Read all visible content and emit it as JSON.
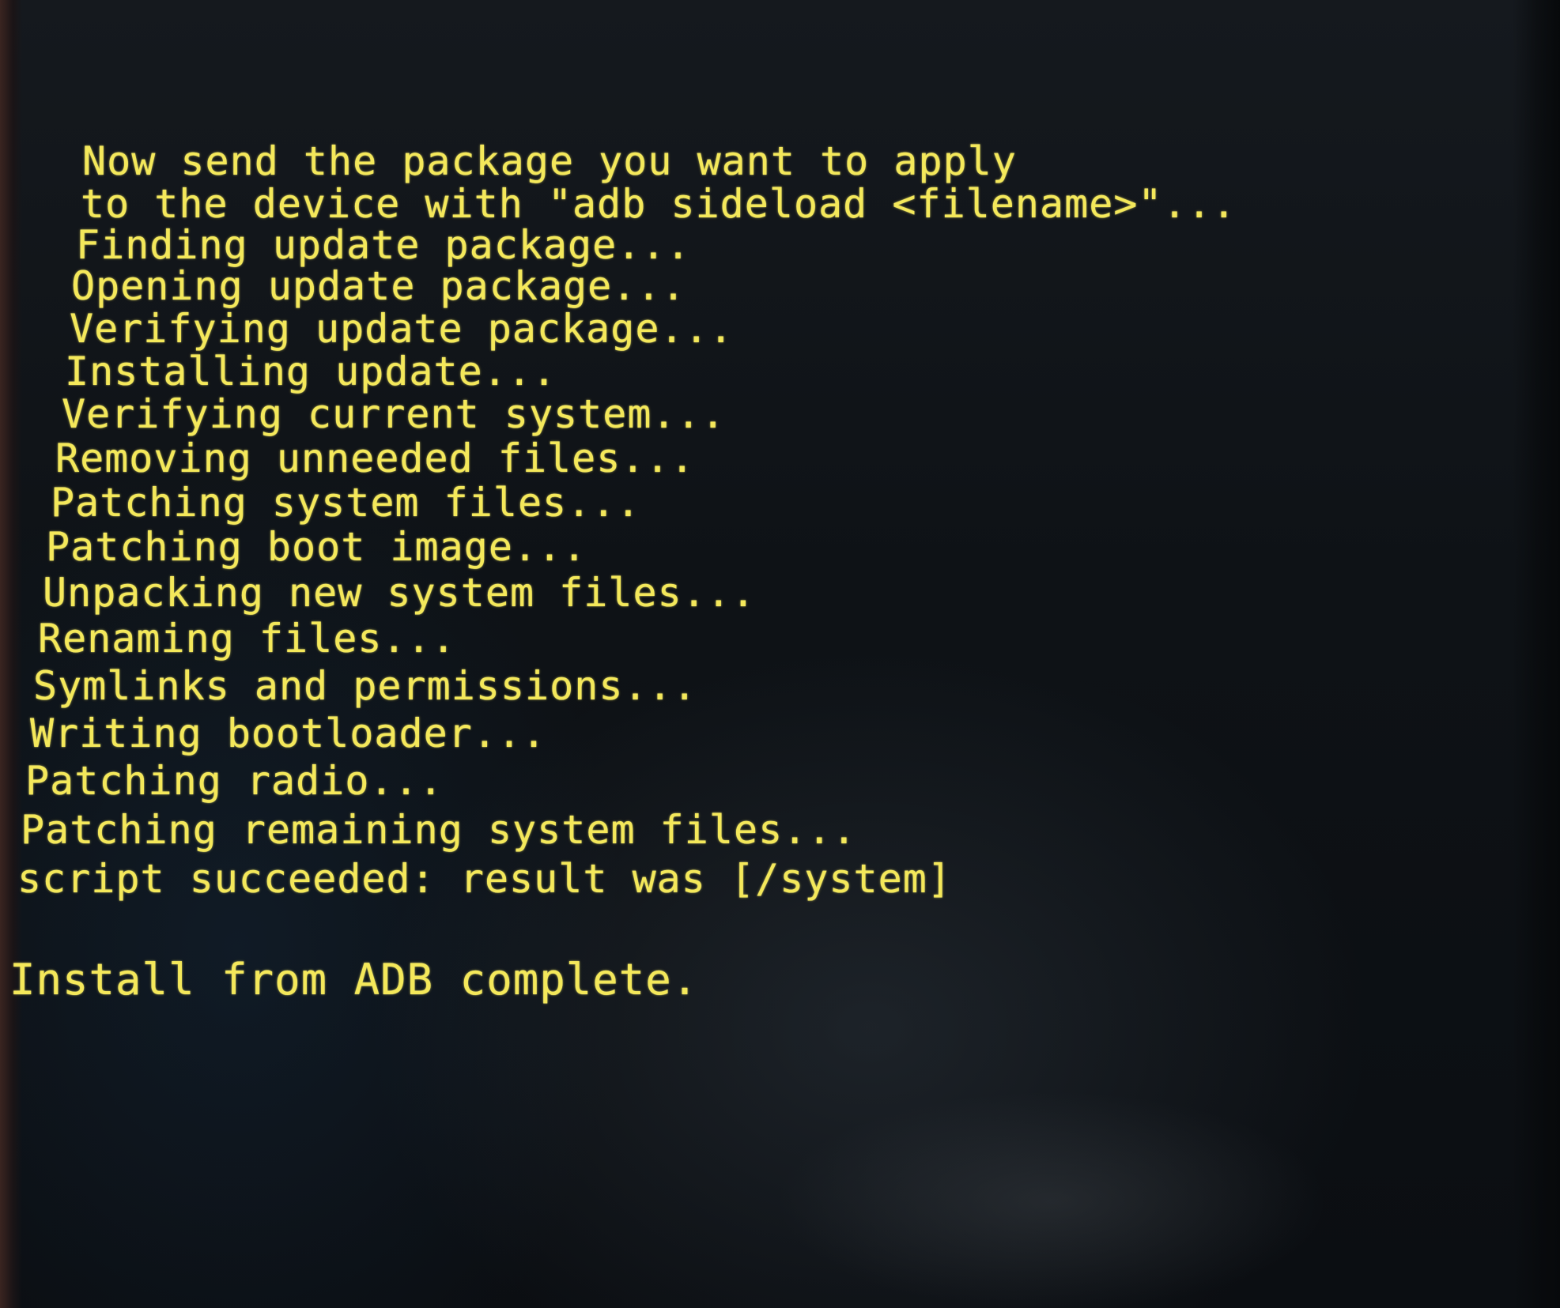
{
  "recovery_log": {
    "lines": [
      "Now send the package you want to apply",
      "to the device with \"adb sideload <filename>\"...",
      "Finding update package...",
      "Opening update package...",
      "Verifying update package...",
      "Installing update...",
      "Verifying current system...",
      "Removing unneeded files...",
      "Patching system files...",
      "Patching boot image...",
      "Unpacking new system files...",
      "Renaming files...",
      "Symlinks and permissions...",
      "Writing bootloader...",
      "Patching radio...",
      "Patching remaining system files...",
      "script succeeded: result was [/system]"
    ],
    "final_status": "Install from ADB complete."
  },
  "colors": {
    "text": "#f4e85a",
    "background": "#0c1014"
  }
}
